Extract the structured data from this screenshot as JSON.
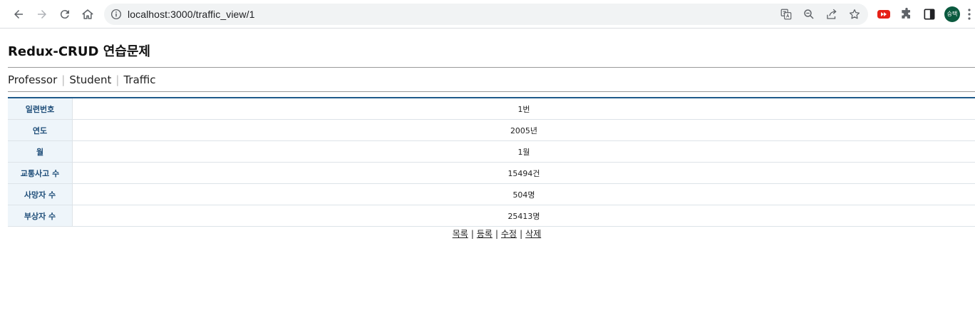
{
  "browser": {
    "url": "localhost:3000/traffic_view/1",
    "avatar_text": "승택"
  },
  "page": {
    "title": "Redux-CRUD 연습문제",
    "nav": [
      "Professor",
      "Student",
      "Traffic"
    ]
  },
  "detail": {
    "rows": [
      {
        "label": "일련번호",
        "value": "1번"
      },
      {
        "label": "연도",
        "value": "2005년"
      },
      {
        "label": "월",
        "value": "1월"
      },
      {
        "label": "교통사고 수",
        "value": "15494건"
      },
      {
        "label": "사망자 수",
        "value": "504명"
      },
      {
        "label": "부상자 수",
        "value": "25413명"
      }
    ]
  },
  "actions": {
    "list": "목록",
    "add": "등록",
    "edit": "수정",
    "delete": "삭제"
  },
  "colors": {
    "table_header_bg": "#eef5fa",
    "table_header_text": "#1f4e79",
    "table_top_border": "#1f5a8a",
    "avatar_bg": "#0b5a3f"
  }
}
